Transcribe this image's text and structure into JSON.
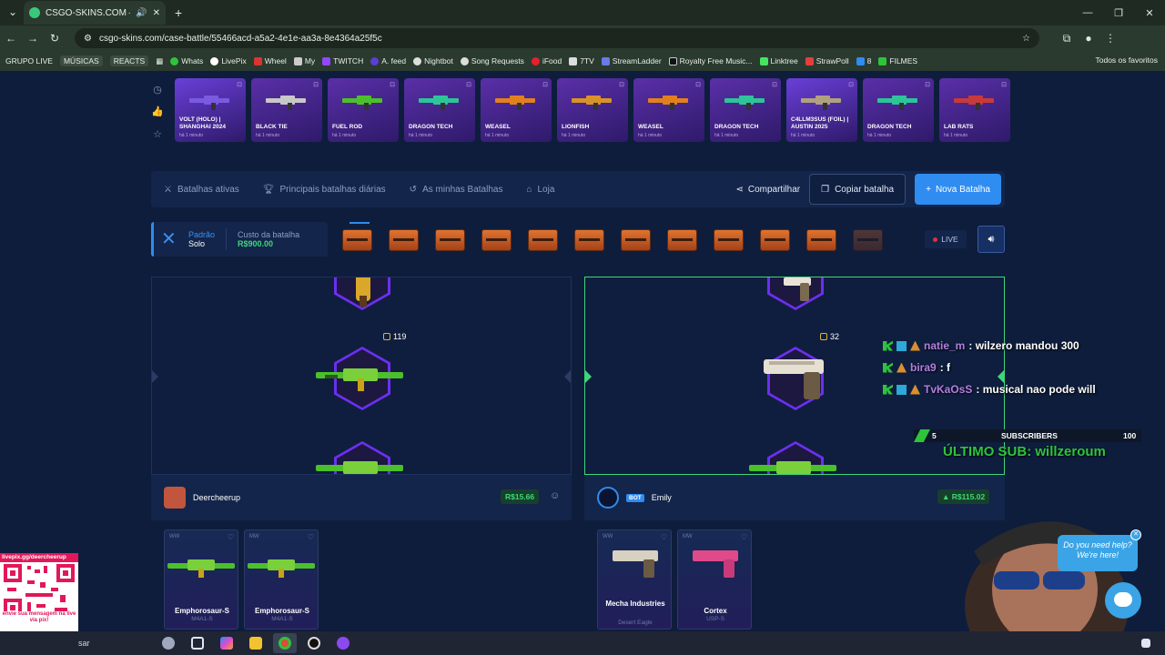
{
  "browser": {
    "tab_title": "CSGO-SKINS.COM — As m",
    "url": "csgo-skins.com/case-battle/55466acd-a5a2-4e1e-aa3a-8e4364a25f5c",
    "bookmarks": [
      "GRUPO LIVE",
      "MÚSICAS",
      "REACTS",
      "Whats",
      "LivePix",
      "Wheel",
      "My",
      "TWITCH",
      "A. feed",
      "Nightbot",
      "Song Requests",
      "iFood",
      "7TV",
      "StreamLadder",
      "Royalty Free Music...",
      "Linktree",
      "StrawPoll",
      "8",
      "FILMES"
    ],
    "bookmarks_right": "Todos os favoritos"
  },
  "live_drops": [
    {
      "name": "VOLT (HOLO) | SHANGHAI 2024",
      "time": "há 1 minuto",
      "color": "#6a3fd8"
    },
    {
      "name": "BLACK TIE",
      "time": "há 1 minuto",
      "color": "#5a2fa8"
    },
    {
      "name": "FUEL ROD",
      "time": "há 1 minuto",
      "color": "#5a2fa8"
    },
    {
      "name": "DRAGON TECH",
      "time": "há 1 minuto",
      "color": "#5a2fa8"
    },
    {
      "name": "WEASEL",
      "time": "há 1 minuto",
      "color": "#5a2fa8"
    },
    {
      "name": "LIONFISH",
      "time": "há 1 minuto",
      "color": "#5a2fa8"
    },
    {
      "name": "WEASEL",
      "time": "há 1 minuto",
      "color": "#5a2fa8"
    },
    {
      "name": "DRAGON TECH",
      "time": "há 1 minuto",
      "color": "#5a2fa8"
    },
    {
      "name": "C4LLM3SUS (FOIL) | AUSTIN 2025",
      "time": "há 1 minuto",
      "color": "#6a3fd8"
    },
    {
      "name": "DRAGON TECH",
      "time": "há 1 minuto",
      "color": "#5a2fa8"
    },
    {
      "name": "LAB RATS",
      "time": "há 1 minuto",
      "color": "#5a2fa8"
    }
  ],
  "nav": {
    "active_battles": "Batalhas ativas",
    "top_daily": "Principais batalhas diárias",
    "my_battles": "As minhas Batalhas",
    "store": "Loja",
    "share": "Compartilhar",
    "copy": "Copiar batalha",
    "new": "Nova Batalha"
  },
  "battle": {
    "mode_label": "Padrão",
    "mode_value": "Solo",
    "cost_label": "Custo da batalha",
    "cost_value": "R$900.00",
    "live": "LIVE",
    "case_count": 12
  },
  "reels": {
    "left_coins": "119",
    "right_coins": "32"
  },
  "players": {
    "left": {
      "name": "Deercheerup",
      "value": "R$15.66"
    },
    "right": {
      "name": "Emily",
      "bot_tag": "BOT",
      "value": "R$115.02"
    }
  },
  "won_items": {
    "left": [
      {
        "cond": "WW",
        "name": "Emphorosaur-S",
        "type": "M4A1-S"
      },
      {
        "cond": "MW",
        "name": "Emphorosaur-S",
        "type": "M4A1-S"
      }
    ],
    "right": [
      {
        "cond": "WW",
        "name": "Mecha Industries",
        "type": "Desert Eagle"
      },
      {
        "cond": "MW",
        "name": "Cortex",
        "type": "USP-S"
      }
    ]
  },
  "overlay": {
    "chat": [
      {
        "user": "natie_m",
        "msg": ": wilzero mandou 300"
      },
      {
        "user": "bira9",
        "msg": ": f"
      },
      {
        "user": "TvKaOsS",
        "msg": ": musical nao pode will"
      }
    ],
    "sub_count": "5",
    "sub_label": "SUBSCRIBERS",
    "sub_goal": "100",
    "last_sub": "ÚLTIMO SUB: willzeroum",
    "help_line1": "Do you need help?",
    "help_line2": "We're here!",
    "qr_top": "livepix.gg/deercheerup",
    "qr_bottom": "envie sua mensagem na live via pix!"
  },
  "taskbar": {
    "search_placeholder": "sar"
  }
}
